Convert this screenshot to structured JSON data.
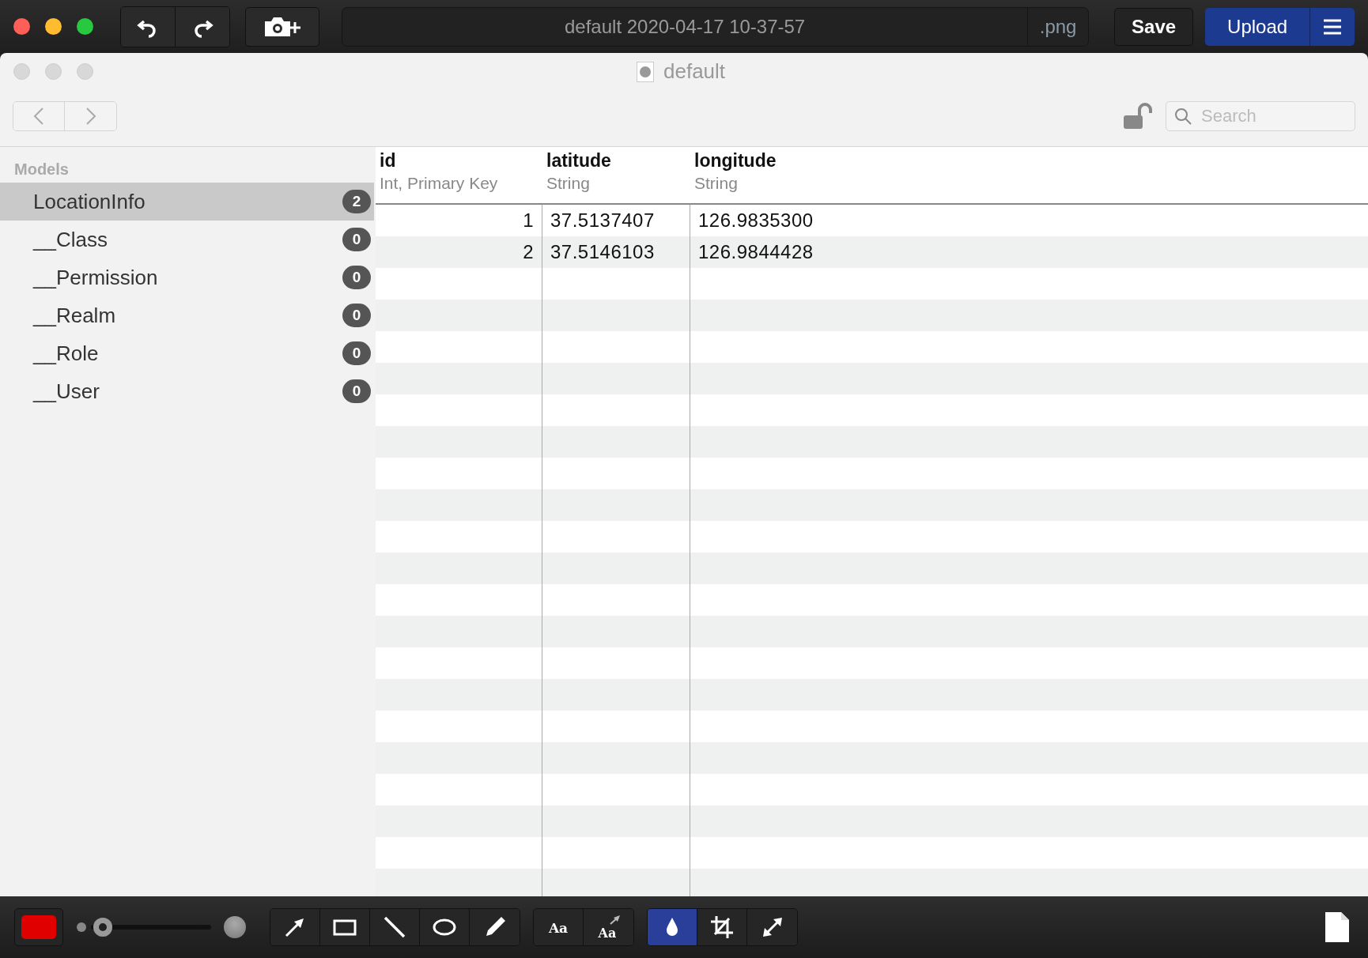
{
  "app_bar": {
    "file_name": "default 2020-04-17 10-37-57",
    "extension": ".png",
    "save": "Save",
    "upload": "Upload"
  },
  "window": {
    "title": "default"
  },
  "search": {
    "placeholder": "Search"
  },
  "sidebar": {
    "header": "Models",
    "items": [
      {
        "name": "LocationInfo",
        "count": "2",
        "selected": true
      },
      {
        "name": "__Class",
        "count": "0",
        "selected": false
      },
      {
        "name": "__Permission",
        "count": "0",
        "selected": false
      },
      {
        "name": "__Realm",
        "count": "0",
        "selected": false
      },
      {
        "name": "__Role",
        "count": "0",
        "selected": false
      },
      {
        "name": "__User",
        "count": "0",
        "selected": false
      }
    ]
  },
  "table": {
    "columns": [
      {
        "name": "id",
        "type": "Int, Primary Key"
      },
      {
        "name": "latitude",
        "type": "String"
      },
      {
        "name": "longitude",
        "type": "String"
      }
    ],
    "rows": [
      [
        "1",
        "37.5137407",
        "126.9835300"
      ],
      [
        "2",
        "37.5146103",
        "126.9844428"
      ]
    ]
  },
  "bottom_toolbar": {
    "color_swatch": {
      "color": "#e00000"
    },
    "width_slider": {
      "level": 0.1
    },
    "tool_groups": [
      [
        {
          "kind": "arrow",
          "selected": false
        },
        {
          "kind": "rectangle",
          "selected": false
        },
        {
          "kind": "line",
          "selected": false
        },
        {
          "kind": "ellipse",
          "selected": false
        },
        {
          "kind": "pencil",
          "selected": false
        }
      ],
      [
        {
          "kind": "text",
          "label": "Aa",
          "selected": false
        },
        {
          "kind": "text-arrow",
          "label": "Aa",
          "selected": false
        }
      ],
      [
        {
          "kind": "drop",
          "selected": true
        },
        {
          "kind": "crop",
          "selected": false
        },
        {
          "kind": "resize",
          "selected": false
        }
      ]
    ]
  }
}
